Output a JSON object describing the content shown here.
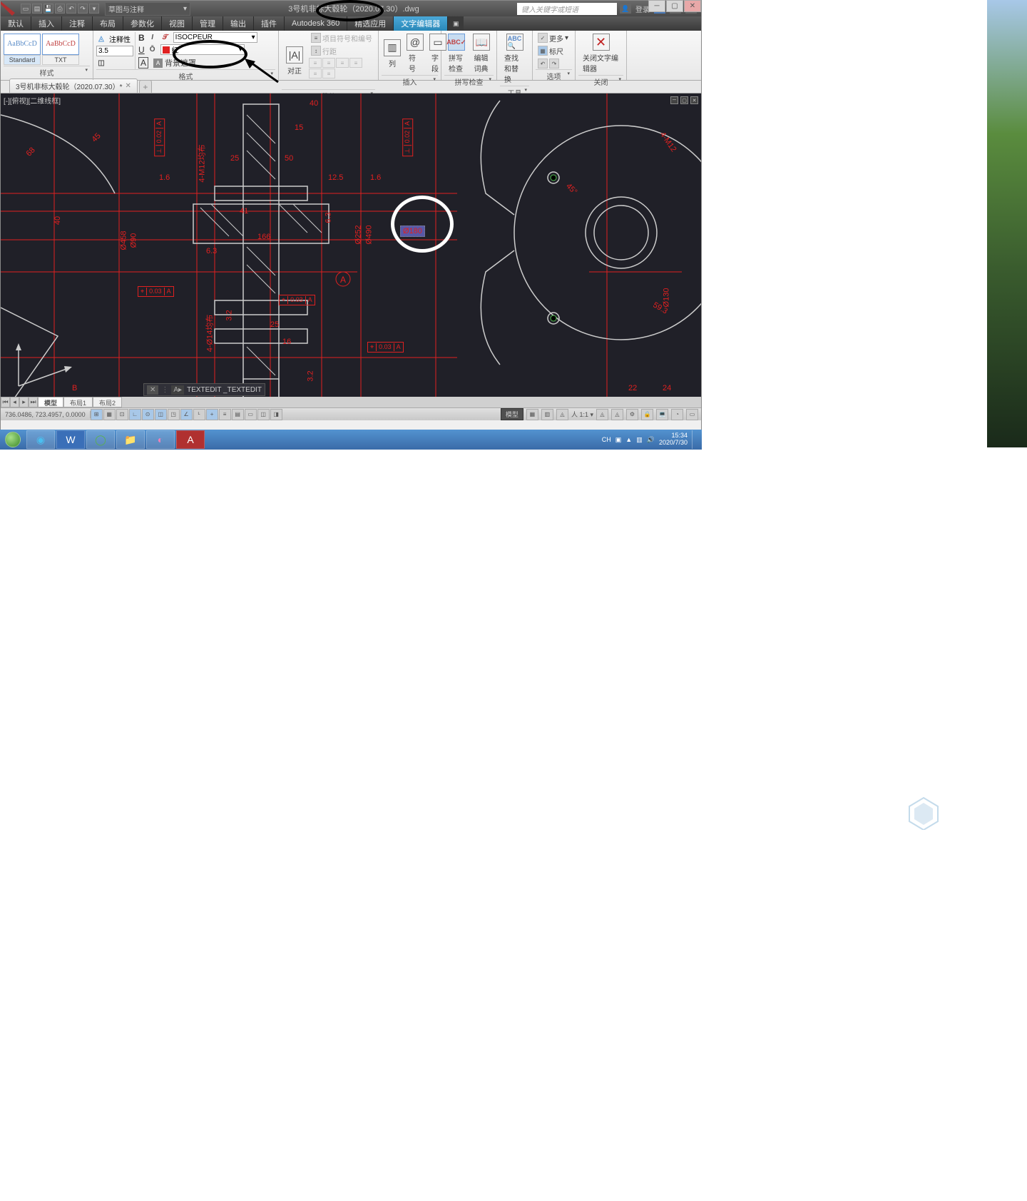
{
  "title": "3号机非标大毂轮（2020.07.30）.dwg",
  "workspace": "草图与注释",
  "search_placeholder": "键入关键字或短语",
  "login": "登录",
  "tabs": [
    "默认",
    "插入",
    "注释",
    "布局",
    "参数化",
    "视图",
    "管理",
    "输出",
    "插件",
    "Autodesk 360",
    "精选应用",
    "文字编辑器"
  ],
  "active_tab": "文字编辑器",
  "styles": {
    "sample1": "AaBbCcD",
    "name1": "Standard",
    "sample2": "AaBbCcD",
    "name2": "TXT",
    "panel_label": "样式"
  },
  "format": {
    "annotative": "注释性",
    "height": "3.5",
    "font": "ISOCPEUR",
    "color": "红",
    "bgmask": "背景遮罩",
    "panel_label": "格式"
  },
  "ribbon_panels": {
    "justify": "对正",
    "paragraph": "段落",
    "bullets": "项目符号和编号",
    "linespace": "行距",
    "columns": "列",
    "symbol": "符号",
    "field": "字段",
    "insert": "插入",
    "spellcheck_btn": "拼写检查",
    "dict": "编辑词典",
    "spellcheck": "拼写检查",
    "findreplace": "查找和替换",
    "tools": "工具",
    "more": "更多",
    "ruler": "标尺",
    "options": "选项",
    "close_btn": "关闭文字编辑器",
    "close": "关闭"
  },
  "file_tab": "3号机非标大毂轮（2020.07.30）*",
  "viewport_label": "[-][俯视][二维线框]",
  "dims": {
    "d40t": "40",
    "d15": "15",
    "d50": "50",
    "d12_5": "12.5",
    "d1_6a": "1.6",
    "d1_6b": "1.6",
    "d25": "25",
    "d68": "68",
    "d45": "45",
    "d40l": "40",
    "phi458": "Ø458",
    "phi90": "Ø90",
    "d4m12": "4-M12均布",
    "d41": "41",
    "d166": "166",
    "d6_3a": "6.3",
    "d6_3b": "6.3",
    "phi252": "Ø252",
    "phi490": "Ø490",
    "d25b": "25",
    "d16": "16",
    "d3_2a": "3.2",
    "d3_2b": "3.2",
    "d4phi14": "4-Ø14均布",
    "tol003a": "0.03",
    "sA1": "A",
    "tol002a": "0.02",
    "tol002b": "0.02",
    "tol003b": "0.03",
    "tol003c": "0.03",
    "datumA": "A",
    "sel": "Ø180",
    "phi130": "Ø130",
    "d59_3": "59.3",
    "ang45": "45°",
    "d4m12r": "4-M12",
    "d22": "22",
    "d24": "24",
    "ucsB": "B"
  },
  "cmdline": {
    "prompt": "TEXTEDIT _TEXTEDIT"
  },
  "layout_tabs": {
    "model": "模型",
    "l1": "布局1",
    "l2": "布局2"
  },
  "statusbar": {
    "coords": "736.0486, 723.4957, 0.0000",
    "model": "模型",
    "scale": "1:1",
    "anno": "A"
  },
  "taskbar": {
    "lang": "CH",
    "time": "15:34",
    "date": "2020/7/30"
  }
}
